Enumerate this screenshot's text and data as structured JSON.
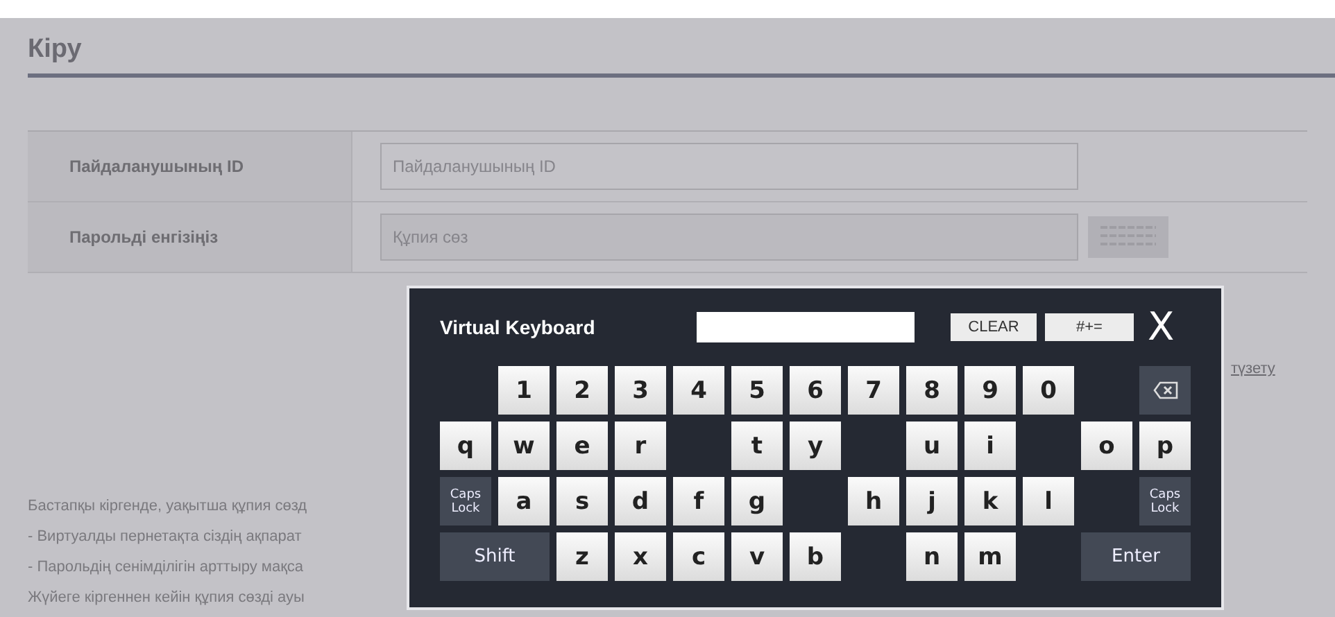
{
  "page": {
    "title": "Кіру"
  },
  "form": {
    "rows": [
      {
        "label": "Пайдаланушының ID",
        "placeholder": "Пайдаланушының ID",
        "kind": "text"
      },
      {
        "label": "Парольді енгізіңіз",
        "placeholder": "Құпия сөз",
        "kind": "password"
      }
    ]
  },
  "link": "түзету",
  "notes": [
    "Бастапқы кіргенде, уақытша құпия сөзд",
    "- Виртуалды пернетақта сіздің ақпарат",
    "- Парольдің сенімділігін арттыру мақса",
    "Жүйеге кіргеннен кейін құпия сөзді ауы"
  ],
  "keyboard": {
    "title": "Virtual Keyboard",
    "buttons": [
      "CLEAR",
      "#+="
    ],
    "close": "X",
    "key_rows": [
      {
        "keys": [
          {
            "kind": "gap"
          },
          {
            "kind": "key",
            "label": "1"
          },
          {
            "kind": "key",
            "label": "2"
          },
          {
            "kind": "key",
            "label": "3"
          },
          {
            "kind": "key",
            "label": "4"
          },
          {
            "kind": "key",
            "label": "5"
          },
          {
            "kind": "key",
            "label": "6"
          },
          {
            "kind": "key",
            "label": "7"
          },
          {
            "kind": "key",
            "label": "8"
          },
          {
            "kind": "key",
            "label": "9"
          },
          {
            "kind": "key",
            "label": "0"
          },
          {
            "kind": "gap"
          },
          {
            "kind": "backspace"
          }
        ]
      },
      {
        "keys": [
          {
            "kind": "key",
            "label": "q"
          },
          {
            "kind": "key",
            "label": "w"
          },
          {
            "kind": "key",
            "label": "e"
          },
          {
            "kind": "key",
            "label": "r"
          },
          {
            "kind": "gap"
          },
          {
            "kind": "key",
            "label": "t"
          },
          {
            "kind": "key",
            "label": "y"
          },
          {
            "kind": "gap"
          },
          {
            "kind": "key",
            "label": "u"
          },
          {
            "kind": "key",
            "label": "i"
          },
          {
            "kind": "gap"
          },
          {
            "kind": "key",
            "label": "o"
          },
          {
            "kind": "key",
            "label": "p"
          }
        ]
      },
      {
        "keys": [
          {
            "kind": "function",
            "label": "Caps Lock"
          },
          {
            "kind": "key",
            "label": "a"
          },
          {
            "kind": "key",
            "label": "s"
          },
          {
            "kind": "key",
            "label": "d"
          },
          {
            "kind": "key",
            "label": "f"
          },
          {
            "kind": "key",
            "label": "g"
          },
          {
            "kind": "gap"
          },
          {
            "kind": "key",
            "label": "h"
          },
          {
            "kind": "key",
            "label": "j"
          },
          {
            "kind": "key",
            "label": "k"
          },
          {
            "kind": "key",
            "label": "l"
          },
          {
            "kind": "gap"
          },
          {
            "kind": "function",
            "label": "Caps Lock"
          }
        ]
      },
      {
        "keys": [
          {
            "kind": "wide",
            "label": "Shift"
          },
          {
            "kind": "key",
            "label": "z"
          },
          {
            "kind": "key",
            "label": "x"
          },
          {
            "kind": "key",
            "label": "c"
          },
          {
            "kind": "key",
            "label": "v"
          },
          {
            "kind": "key",
            "label": "b"
          },
          {
            "kind": "gap"
          },
          {
            "kind": "key",
            "label": "n"
          },
          {
            "kind": "key",
            "label": "m"
          },
          {
            "kind": "gap"
          },
          {
            "kind": "wide",
            "label": "Enter"
          }
        ]
      }
    ]
  }
}
